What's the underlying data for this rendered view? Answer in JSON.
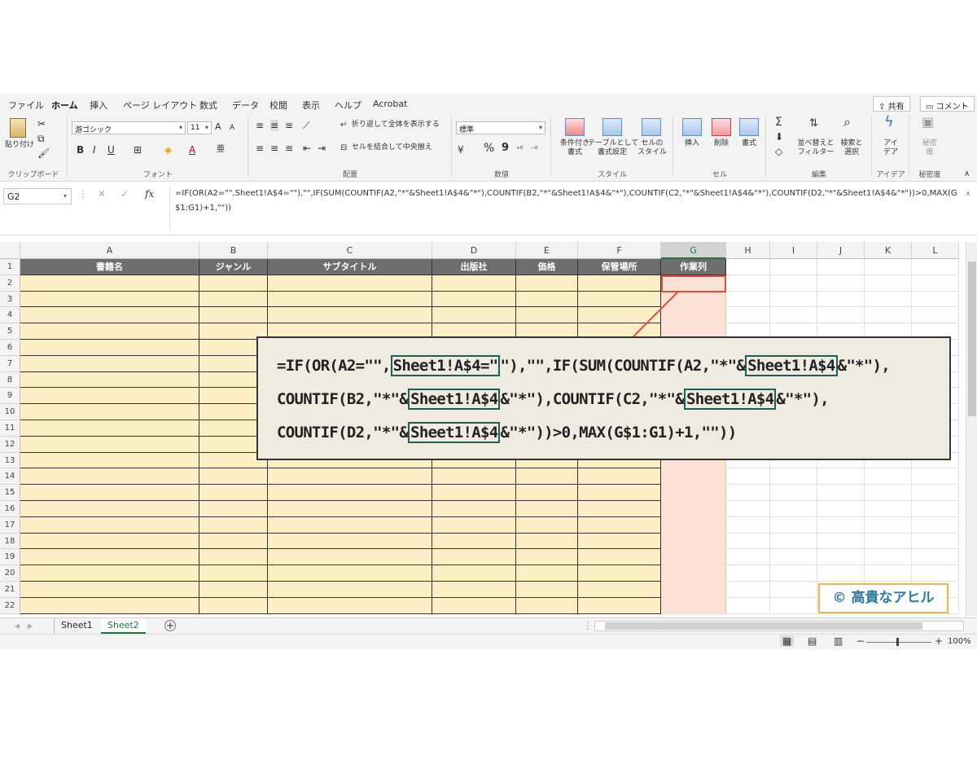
{
  "menu": {
    "tabs": [
      "ファイル",
      "ホーム",
      "挿入",
      "ページ レイアウト",
      "数式",
      "データ",
      "校閲",
      "表示",
      "ヘルプ",
      "Acrobat"
    ],
    "active_tab": "ホーム",
    "share_label": "共有",
    "comment_label": "コメント"
  },
  "ribbon": {
    "clipboard": {
      "paste": "貼り付け",
      "label": "クリップボード"
    },
    "font": {
      "name": "游ゴシック",
      "size": "11",
      "bold": "B",
      "italic": "I",
      "underline": "U",
      "grow": "A",
      "shrink": "A",
      "color_a": "A",
      "label": "フォント"
    },
    "alignment": {
      "wrap": "折り返して全体を表示する",
      "merge": "セルを結合して中央揃え",
      "label": "配置"
    },
    "number": {
      "format": "標準",
      "percent": "%",
      "comma": "9",
      "label": "数値"
    },
    "styles": {
      "conditional": "条件付き\n書式",
      "table": "テーブルとして\n書式設定",
      "cell": "セルの\nスタイル",
      "label": "スタイル"
    },
    "cells": {
      "insert": "挿入",
      "delete": "削除",
      "format": "書式",
      "label": "セル"
    },
    "editing": {
      "sort": "並べ替えと\nフィルター",
      "find": "検索と\n選択",
      "label": "編集"
    },
    "ideas": {
      "btn": "アイ\nデア",
      "label": "アイデア"
    },
    "sensitivity": {
      "btn": "秘密\n度",
      "label": "秘密度"
    }
  },
  "formula_bar": {
    "name_box": "G2",
    "fx": "fx",
    "formula": "=IF(OR(A2=\"\",Sheet1!A$4=\"\"),\"\",IF(SUM(COUNTIF(A2,\"*\"&Sheet1!A$4&\"*\"),COUNTIF(B2,\"*\"&Sheet1!A$4&\"*\"),COUNTIF(C2,\"*\"&Sheet1!A$4&\"*\"),COUNTIF(D2,\"*\"&Sheet1!A$4&\"*\"))>0,MAX(G$1:G1)+1,\"\"))"
  },
  "grid": {
    "columns": [
      "A",
      "B",
      "C",
      "D",
      "E",
      "F",
      "G",
      "H",
      "I",
      "J",
      "K",
      "L"
    ],
    "selected_column": "G",
    "headers": [
      "書籍名",
      "ジャンル",
      "サブタイトル",
      "出版社",
      "価格",
      "保管場所",
      "作業列"
    ],
    "rows": [
      "1",
      "2",
      "3",
      "4",
      "5",
      "6",
      "7",
      "8",
      "9",
      "10",
      "11",
      "12",
      "13",
      "14",
      "15",
      "16",
      "17",
      "18",
      "19",
      "20",
      "21",
      "22"
    ],
    "selected_cell": "G2"
  },
  "sheets": {
    "tabs": [
      "Sheet1",
      "Sheet2"
    ],
    "active": "Sheet2",
    "add": "+"
  },
  "status": {
    "zoom": "100%",
    "minus": "−",
    "plus": "+"
  },
  "callout": {
    "lines": [
      [
        "=IF(OR(A2=\"\",",
        {
          "hl": "Sheet1!A$4=\""
        },
        "\"),\"\",IF(SUM(COUNTIF(A2,\"*\"&",
        {
          "hl": "Sheet1!A$4"
        },
        "&\"*\"),"
      ],
      [
        "COUNTIF(B2,\"*\"&",
        {
          "hl": "Sheet1!A$4"
        },
        "&\"*\"),COUNTIF(C2,\"*\"&",
        {
          "hl": "Sheet1!A$4"
        },
        "&\"*\"),"
      ],
      [
        "COUNTIF(D2,\"*\"&",
        {
          "hl": "Sheet1!A$4"
        },
        "&\"*\"))>0,MAX(G$1:G1)+1,\"\"))"
      ]
    ]
  },
  "colors": {
    "accent": "#217346",
    "header_fill": "#6e6e6e",
    "data_fill": "#fdefc5",
    "work_col_fill": "#fce2d6",
    "callout_bg": "#f0ebe1",
    "highlight_border": "#1e5e56",
    "selection_border": "#e74c3c"
  },
  "copyright": "© 高貴なアヒル"
}
